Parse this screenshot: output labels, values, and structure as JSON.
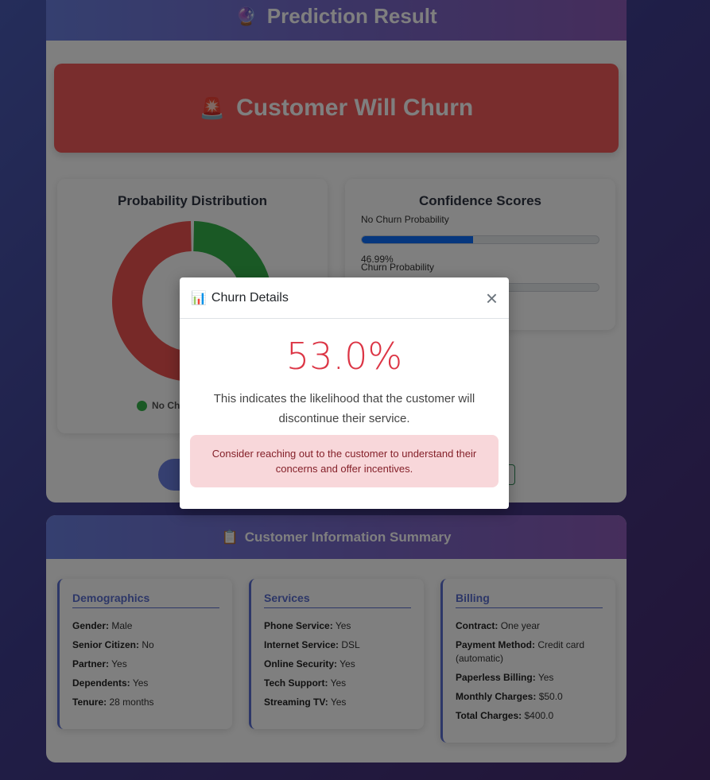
{
  "prediction": {
    "header_emoji": "🔮",
    "title": "Prediction Result",
    "banner_emoji": "🚨",
    "banner_text": "Customer Will Churn"
  },
  "probability": {
    "title": "Probability Distribution",
    "no_churn": 46.99,
    "churn": 53.01,
    "colors": {
      "no_churn": "#34b34a",
      "churn": "#ef5350"
    },
    "legend_label": "No Chu"
  },
  "confidence": {
    "title": "Confidence Scores",
    "no_churn_label": "No Churn Probability",
    "no_churn_value": "46.99%",
    "no_churn_fraction": 0.4699,
    "churn_label": "Churn Probability"
  },
  "summary": {
    "emoji": "📋",
    "title": "Customer Information Summary",
    "columns": [
      {
        "title": "Demographics",
        "rows": [
          {
            "k": "Gender:",
            "v": "Male"
          },
          {
            "k": "Senior Citizen:",
            "v": "No"
          },
          {
            "k": "Partner:",
            "v": "Yes"
          },
          {
            "k": "Dependents:",
            "v": "Yes"
          },
          {
            "k": "Tenure:",
            "v": "28 months"
          }
        ]
      },
      {
        "title": "Services",
        "rows": [
          {
            "k": "Phone Service:",
            "v": "Yes"
          },
          {
            "k": "Internet Service:",
            "v": "DSL"
          },
          {
            "k": "Online Security:",
            "v": "Yes"
          },
          {
            "k": "Tech Support:",
            "v": "Yes"
          },
          {
            "k": "Streaming TV:",
            "v": "Yes"
          }
        ]
      },
      {
        "title": "Billing",
        "rows": [
          {
            "k": "Contract:",
            "v": "One year"
          },
          {
            "k": "Payment Method:",
            "v": "Credit card (automatic)"
          },
          {
            "k": "Paperless Billing:",
            "v": "Yes"
          },
          {
            "k": "Monthly Charges:",
            "v": "$50.0"
          },
          {
            "k": "Total Charges:",
            "v": "$400.0"
          }
        ]
      }
    ]
  },
  "modal": {
    "icon": "📊",
    "title": "Churn Details",
    "close": "×",
    "percent": "53.0%",
    "description": "This indicates the likelihood that the customer will discontinue their service.",
    "alert": "Consider reaching out to the customer to understand their concerns and offer incentives."
  }
}
